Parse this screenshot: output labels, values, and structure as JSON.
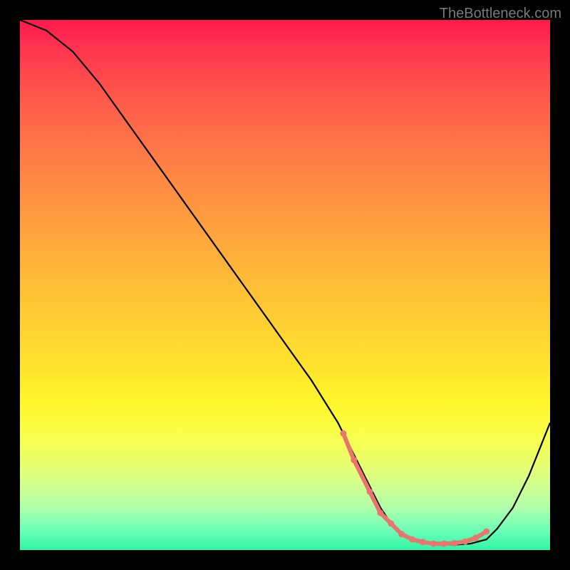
{
  "watermark": "TheBottleneck.com",
  "chart_data": {
    "type": "line",
    "title": "",
    "xlabel": "",
    "ylabel": "",
    "xlim": [
      0,
      100
    ],
    "ylim": [
      0,
      100
    ],
    "series": [
      {
        "name": "bottleneck-curve",
        "x": [
          0,
          5,
          10,
          15,
          20,
          25,
          30,
          35,
          40,
          45,
          50,
          55,
          60,
          62,
          65,
          68,
          70,
          73,
          75,
          78,
          80,
          82,
          85,
          88,
          90,
          93,
          96,
          100
        ],
        "y": [
          100,
          98,
          94,
          88,
          81,
          74,
          67,
          60,
          53,
          46,
          39,
          32,
          24,
          20,
          14,
          8,
          5,
          2.5,
          1.5,
          1,
          1,
          1,
          1.2,
          2,
          4,
          8,
          14,
          24
        ]
      }
    ],
    "markers": {
      "name": "highlight-dots",
      "x": [
        61,
        63,
        66,
        68,
        70,
        72,
        74,
        76,
        78,
        80,
        82,
        84,
        86,
        88
      ],
      "y": [
        22,
        17,
        11,
        7,
        5,
        3,
        2,
        1.5,
        1.2,
        1.2,
        1.3,
        1.6,
        2.3,
        3.5
      ]
    },
    "colors": {
      "curve": "#000000",
      "markers": "#e8766f",
      "gradient_top": "#ff1a4d",
      "gradient_bottom": "#30f5a5"
    }
  }
}
